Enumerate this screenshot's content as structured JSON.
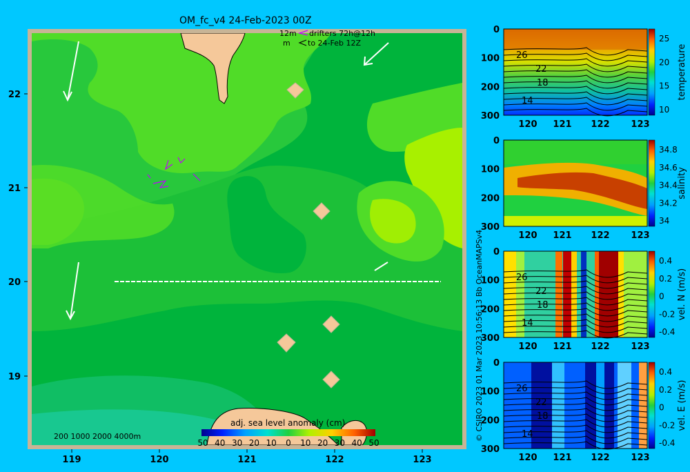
{
  "header": {
    "title": "OM_fc_v4  24-Feb-2023 00Z",
    "drifter_depth": "12m",
    "drifter_label": "drifters 72h@12h",
    "drifter_depth2": "m",
    "drifter_to": "to 24-Feb 12Z"
  },
  "side_text": "© CSIRO 2023   01 Mar 2023 10:56:13 Bb  OceanMAPSv4",
  "map": {
    "depth_labels": "200  1000  2000  4000m",
    "colorbar_title": "adj. sea level anomaly (cm)",
    "colorbar_ticks": [
      "50",
      "40",
      "30",
      "20",
      "10",
      "0",
      "10",
      "20",
      "30",
      "40",
      "50"
    ],
    "xticks": [
      "119",
      "120",
      "121",
      "122",
      "123"
    ],
    "yticks": [
      "22",
      "21",
      "20",
      "19"
    ],
    "section_line_lat": "20"
  },
  "colors": {
    "background": "#00c8ff",
    "map_green_dark": "#00b43c",
    "map_green": "#18c838",
    "map_green_light": "#50dc28",
    "map_yellow_green": "#a8f000",
    "land": "#f5c89a",
    "frame": "#c8b496"
  },
  "chart_data": [
    {
      "type": "heatmap",
      "title": "adj. sea level anomaly (cm)",
      "x_ticks": [
        119,
        120,
        121,
        122,
        123
      ],
      "y_ticks": [
        19,
        20,
        21,
        22
      ],
      "xlim": [
        118.55,
        123.5
      ],
      "ylim": [
        18.3,
        22.7
      ],
      "colorbar_range": [
        -50,
        50
      ],
      "section_latitude": 20,
      "section_lon_range": [
        119.5,
        123.2
      ]
    },
    {
      "type": "heatmap",
      "ylabel": "temperature",
      "x_ticks": [
        120,
        121,
        122,
        123
      ],
      "y_ticks": [
        0,
        100,
        200,
        300
      ],
      "colorbar_ticks": [
        "25",
        "20",
        "15",
        "10"
      ],
      "contour_labels": [
        "26",
        "22",
        "18",
        "14"
      ]
    },
    {
      "type": "heatmap",
      "ylabel": "salinity",
      "x_ticks": [
        120,
        121,
        122,
        123
      ],
      "y_ticks": [
        0,
        100,
        200,
        300
      ],
      "colorbar_ticks": [
        "34.8",
        "34.6",
        "34.4",
        "34.2",
        "34"
      ]
    },
    {
      "type": "heatmap",
      "ylabel": "vel. N (m/s)",
      "x_ticks": [
        120,
        121,
        122,
        123
      ],
      "y_ticks": [
        0,
        100,
        200,
        300
      ],
      "colorbar_ticks": [
        "0.4",
        "0.2",
        "0",
        "-0.2",
        "-0.4"
      ],
      "contour_labels": [
        "26",
        "22",
        "18",
        "14"
      ]
    },
    {
      "type": "heatmap",
      "ylabel": "vel. E (m/s)",
      "x_ticks": [
        120,
        121,
        122,
        123
      ],
      "y_ticks": [
        0,
        100,
        200,
        300
      ],
      "colorbar_ticks": [
        "0.4",
        "0.2",
        "0",
        "-0.2",
        "-0.4"
      ],
      "contour_labels": [
        "26",
        "22",
        "18",
        "14"
      ]
    }
  ],
  "panels": [
    {
      "ylabel": "temperature",
      "y": [
        "0",
        "100",
        "200",
        "300"
      ],
      "x": [
        "120",
        "121",
        "122",
        "123"
      ],
      "cb": [
        "25",
        "20",
        "15",
        "10"
      ],
      "labels": [
        "26",
        "22",
        "18",
        "14"
      ]
    },
    {
      "ylabel": "salinity",
      "y": [
        "0",
        "100",
        "200",
        "300"
      ],
      "x": [
        "120",
        "121",
        "122",
        "123"
      ],
      "cb": [
        "34.8",
        "34.6",
        "34.4",
        "34.2",
        "34"
      ],
      "labels": []
    },
    {
      "ylabel": "vel. N (m/s)",
      "y": [
        "0",
        "100",
        "200",
        "300"
      ],
      "x": [
        "120",
        "121",
        "122",
        "123"
      ],
      "cb": [
        "0.4",
        "0.2",
        "0",
        "-0.2",
        "-0.4"
      ],
      "labels": [
        "26",
        "22",
        "18",
        "14"
      ]
    },
    {
      "ylabel": "vel. E (m/s)",
      "y": [
        "0",
        "100",
        "200",
        "300"
      ],
      "x": [
        "120",
        "121",
        "122",
        "123"
      ],
      "cb": [
        "0.4",
        "0.2",
        "0",
        "-0.2",
        "-0.4"
      ],
      "labels": [
        "26",
        "22",
        "18",
        "14"
      ]
    }
  ]
}
